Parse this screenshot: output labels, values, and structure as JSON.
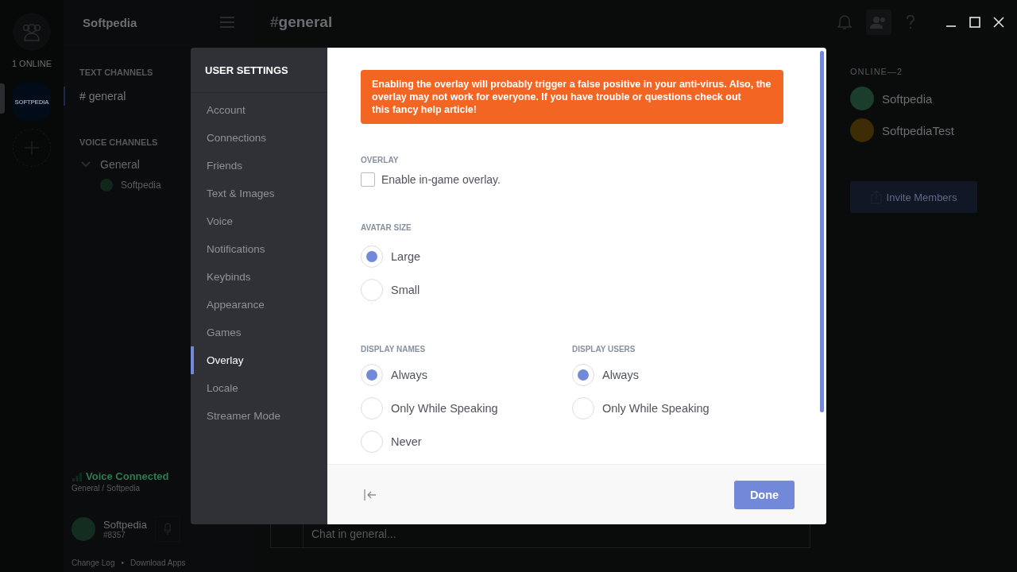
{
  "rail": {
    "online_label": "1 ONLINE",
    "servers": [
      {
        "label": "SOFTPEDIA",
        "selected": true
      }
    ]
  },
  "sidebar": {
    "server_name": "Softpedia",
    "text_title": "TEXT CHANNELS",
    "text_channels": [
      {
        "name": "# general",
        "selected": true
      }
    ],
    "voice_title": "VOICE CHANNELS",
    "voice_channels": [
      {
        "name": "General",
        "expanded": true,
        "children": [
          {
            "name": "Softpedia"
          }
        ]
      }
    ],
    "voice_status": {
      "title": "Voice Connected",
      "subtitle": "General / Softpedia"
    },
    "user": {
      "name": "Softpedia",
      "tag": "#8357"
    },
    "footer_links": [
      "Change Log",
      "Download Apps"
    ],
    "footer_separator": "•"
  },
  "header": {
    "hash": "#",
    "channel": "general"
  },
  "chat_input": {
    "placeholder": "Chat in general..."
  },
  "members": {
    "title": "ONLINE—2",
    "list": [
      {
        "name": "Softpedia",
        "color": "#1a3d2c"
      },
      {
        "name": "SoftpediaTest",
        "color": "#3d2c06"
      }
    ],
    "invite": "Invite Members"
  },
  "modal": {
    "title": "USER SETTINGS",
    "nav": [
      {
        "label": "Account",
        "selected": false
      },
      {
        "label": "Connections",
        "selected": false
      },
      {
        "label": "Friends",
        "selected": false
      },
      {
        "label": "Text & Images",
        "selected": false
      },
      {
        "label": "Voice",
        "selected": false
      },
      {
        "label": "Notifications",
        "selected": false
      },
      {
        "label": "Keybinds",
        "selected": false
      },
      {
        "label": "Appearance",
        "selected": false
      },
      {
        "label": "Games",
        "selected": false
      },
      {
        "label": "Overlay",
        "selected": true
      },
      {
        "label": "Locale",
        "selected": false
      },
      {
        "label": "Streamer Mode",
        "selected": false
      }
    ],
    "warning": {
      "text": "Enabling the overlay will probably trigger a false positive in your anti-virus. Also, the overlay may not work for everyone. If you have trouble or questions check out",
      "link": "this fancy help article!"
    },
    "overlay": {
      "title": "OVERLAY",
      "label": "Enable in-game overlay.",
      "checked": false
    },
    "avatar_size": {
      "title": "AVATAR SIZE",
      "options": [
        {
          "label": "Large",
          "selected": true
        },
        {
          "label": "Small",
          "selected": false
        }
      ]
    },
    "display_names": {
      "title": "DISPLAY NAMES",
      "options": [
        {
          "label": "Always",
          "selected": true
        },
        {
          "label": "Only While Speaking",
          "selected": false
        },
        {
          "label": "Never",
          "selected": false
        }
      ]
    },
    "display_users": {
      "title": "DISPLAY USERS",
      "options": [
        {
          "label": "Always",
          "selected": true
        },
        {
          "label": "Only While Speaking",
          "selected": false
        }
      ]
    },
    "done": "Done"
  }
}
